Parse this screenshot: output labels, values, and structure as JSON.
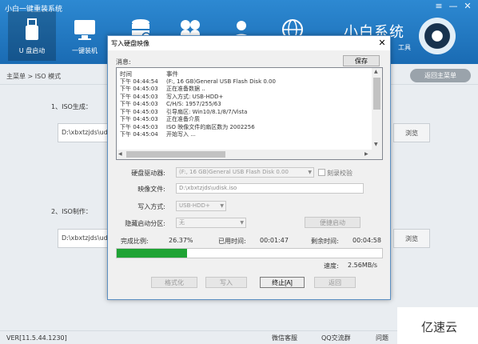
{
  "app": {
    "title": "小白一键重装系统",
    "nav": [
      {
        "label": "U 盘启动",
        "icon": "usb-drive-icon"
      },
      {
        "label": "一键装机",
        "icon": "computer-icon"
      },
      {
        "label": "",
        "icon": "database-icon"
      },
      {
        "label": "",
        "icon": "clover-icon"
      },
      {
        "label": "",
        "icon": "user-icon"
      },
      {
        "label": "",
        "icon": "globe-icon"
      }
    ],
    "brand": "小白系统",
    "brand_sub": "工具",
    "breadcrumb": "主菜单 > ISO 模式",
    "back_button": "返回主菜单",
    "sections": {
      "iso_generate_label": "1、ISO生成：",
      "iso_generate_path": "D:\\xbxtzjds\\udi",
      "iso_make_label": "2、ISO制作：",
      "iso_make_path": "D:\\xbxtzjds\\udi",
      "browse": "浏览"
    },
    "footer": {
      "version": "VER[11.5.44.1230]",
      "links": [
        "微信客服",
        "QQ交流群",
        "问题"
      ]
    },
    "watermark": "亿速云"
  },
  "dialog": {
    "title": "写入硬盘映像",
    "close": "✕",
    "message_label": "消息:",
    "save_button": "保存",
    "log": {
      "headers": [
        "时间",
        "事件"
      ],
      "rows": [
        [
          "下午 04:44:54",
          "(F:, 16 GB)General USB Flash Disk  0.00"
        ],
        [
          "下午 04:45:03",
          "正在准备数据 .."
        ],
        [
          "下午 04:45:03",
          "写入方式: USB-HDD+"
        ],
        [
          "下午 04:45:03",
          "C/H/S: 1957/255/63"
        ],
        [
          "下午 04:45:03",
          "引导扇区: Win10/8.1/8/7/Vista"
        ],
        [
          "下午 04:45:03",
          "正在准备介质"
        ],
        [
          "下午 04:45:03",
          "ISO 映像文件的扇区数为 2002256"
        ],
        [
          "下午 04:45:04",
          "开始写入 ..."
        ]
      ]
    },
    "form": {
      "drive_label": "硬盘驱动器:",
      "drive_value": "(F:, 16 GB)General USB Flash Disk  0.00",
      "verify_label": "刻录校验",
      "image_label": "映像文件:",
      "image_value": "D:\\xbxtzjds\\udisk.iso",
      "write_mode_label": "写入方式:",
      "write_mode_value": "USB-HDD+",
      "hide_partition_label": "隐藏启动分区:",
      "hide_partition_value": "无",
      "fast_boot_button": "便捷启动"
    },
    "progress": {
      "complete_label": "完成比例:",
      "complete_value": "26.37%",
      "elapsed_label": "已用时间:",
      "elapsed_value": "00:01:47",
      "remaining_label": "剩余时间:",
      "remaining_value": "00:04:58",
      "fraction": 0.2637,
      "speed_label": "速度:",
      "speed_value": "2.56MB/s",
      "bar_color": "#1fa334"
    },
    "buttons": {
      "format": "格式化",
      "write": "写入",
      "stop": "终止[A]",
      "back": "返回"
    }
  }
}
